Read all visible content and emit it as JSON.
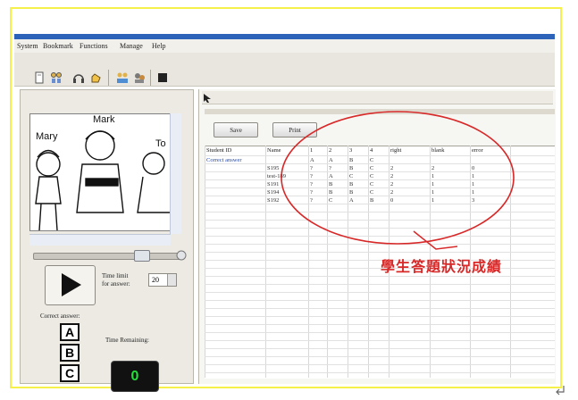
{
  "menu": [
    "System",
    "Bookmark",
    "Functions",
    "Manage",
    "Help"
  ],
  "toolbar": {
    "icons": [
      "page-icon",
      "users-icon",
      "headphones-icon",
      "hand-icon",
      "group-icon",
      "people-icon",
      "stop-icon"
    ],
    "pointer_icon": "pointer-icon"
  },
  "image_panel": {
    "labels": [
      "Mary",
      "Mark",
      "To"
    ]
  },
  "controls": {
    "time_limit_label": "Time limit",
    "for_answer_label": "for answer:",
    "time_limit_value": "20",
    "correct_answer_label": "Correct answer:",
    "answers": [
      "A",
      "B",
      "C"
    ],
    "time_remaining_label": "Time Remaining:",
    "timer_value": "0"
  },
  "results": {
    "save_label": "Save",
    "print_label": "Print",
    "columns": [
      "Student ID",
      "Name",
      "1",
      "2",
      "3",
      "4",
      "right",
      "blank",
      "error"
    ],
    "correct_row": {
      "label": "Correct answer",
      "answers": [
        "A",
        "A",
        "B",
        "C"
      ]
    },
    "rows": [
      {
        "name": "S195",
        "a": [
          "?",
          "?",
          "B",
          "C"
        ],
        "right": "2",
        "blank": "2",
        "error": "0"
      },
      {
        "name": "test-189",
        "a": [
          "?",
          "A",
          "C",
          "C"
        ],
        "right": "2",
        "blank": "1",
        "error": "1"
      },
      {
        "name": "S191",
        "a": [
          "?",
          "B",
          "B",
          "C"
        ],
        "right": "2",
        "blank": "1",
        "error": "1"
      },
      {
        "name": "S194",
        "a": [
          "?",
          "B",
          "B",
          "C"
        ],
        "right": "2",
        "blank": "1",
        "error": "1"
      },
      {
        "name": "S192",
        "a": [
          "?",
          "C",
          "A",
          "B"
        ],
        "right": "0",
        "blank": "1",
        "error": "3"
      }
    ]
  },
  "annotation": {
    "text": "學生答題狀況成績",
    "color": "#d82828"
  },
  "colors": {
    "frame": "#f5f04a",
    "title_bar": "#2d63b8",
    "timer_digits": "#23e03a"
  }
}
